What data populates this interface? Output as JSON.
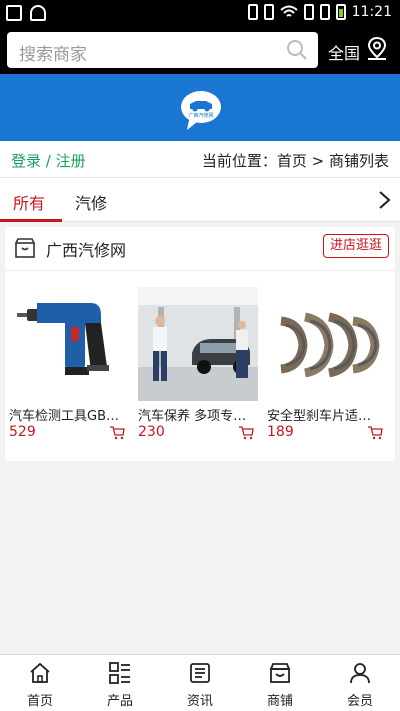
{
  "status_bar": {
    "time": "11:21"
  },
  "search": {
    "placeholder": "搜索商家",
    "region": "全国"
  },
  "logo": {
    "text": "广西汽修网"
  },
  "breadcrumb": {
    "login": "登录 / 注册",
    "location": "当前位置：首页 > 商铺列表"
  },
  "tabs": [
    {
      "label": "所有"
    },
    {
      "label": "汽修"
    }
  ],
  "shop": {
    "name": "广西汽修网",
    "visit_label": "进店逛逛",
    "products": [
      {
        "name": "汽车检测工具GB…",
        "price": "529"
      },
      {
        "name": "汽车保养 多项专…",
        "price": "230"
      },
      {
        "name": "安全型刹车片适…",
        "price": "189"
      }
    ]
  },
  "tabbar": [
    {
      "label": "首页"
    },
    {
      "label": "产品"
    },
    {
      "label": "资讯"
    },
    {
      "label": "商铺"
    },
    {
      "label": "会员"
    }
  ],
  "colors": {
    "accent": "#c8161d",
    "banner": "#1976d2",
    "login": "#1aa160"
  }
}
